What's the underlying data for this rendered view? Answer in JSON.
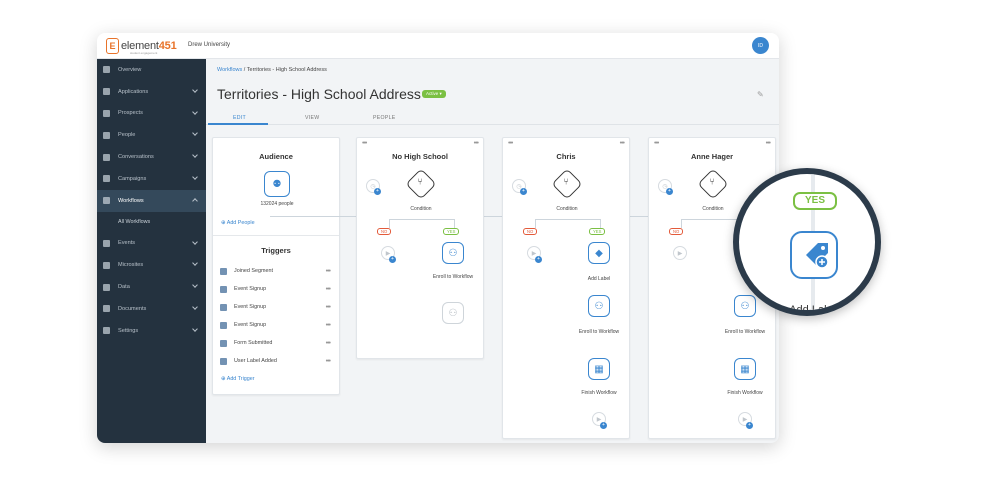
{
  "topbar": {
    "logo_text": "element",
    "logo_num": "451",
    "logo_sub": "student engagement",
    "institution": "Drew University",
    "avatar_initials": "ID"
  },
  "sidebar": {
    "items": [
      {
        "label": "Overview"
      },
      {
        "label": "Applications"
      },
      {
        "label": "Prospects"
      },
      {
        "label": "People"
      },
      {
        "label": "Conversations"
      },
      {
        "label": "Campaigns"
      },
      {
        "label": "Workflows"
      },
      {
        "label": "Events"
      },
      {
        "label": "Microsites"
      },
      {
        "label": "Data"
      },
      {
        "label": "Documents"
      },
      {
        "label": "Settings"
      }
    ],
    "sub_item": "All Workflows"
  },
  "header": {
    "breadcrumb_root": "Workflows",
    "breadcrumb_sep": "/",
    "breadcrumb_current": "Territories - High School Address",
    "title": "Territories - High School Address",
    "status": "Active"
  },
  "tabs": [
    {
      "label": "EDIT"
    },
    {
      "label": "VIEW"
    },
    {
      "label": "PEOPLE"
    }
  ],
  "audience": {
    "title": "Audience",
    "count": "132024 people",
    "add_people": "Add People"
  },
  "triggers": {
    "title": "Triggers",
    "items": [
      {
        "label": "Joined Segment"
      },
      {
        "label": "Event Signup"
      },
      {
        "label": "Event Signup"
      },
      {
        "label": "Event Signup"
      },
      {
        "label": "Form Submitted"
      },
      {
        "label": "User Label Added"
      }
    ],
    "add_trigger": "Add Trigger"
  },
  "columns": [
    {
      "title": "No High School",
      "condition": "Condition",
      "no": "NO",
      "yes": "YES",
      "yes_action": "Enroll to Workflow"
    },
    {
      "title": "Chris",
      "condition": "Condition",
      "no": "NO",
      "yes": "YES",
      "actions": [
        "Add Label",
        "Enroll to Workflow",
        "Finish Workflow"
      ]
    },
    {
      "title": "Anne Hager",
      "condition": "Condition",
      "no": "NO",
      "actions": [
        "Enroll to Workflow",
        "Finish Workflow"
      ]
    }
  ],
  "zoom": {
    "yes": "YES",
    "label": "Add Label"
  },
  "colors": {
    "accent": "#3a86cf",
    "sidebar": "#24323f",
    "yes": "#7bc043",
    "no": "#e35a3a",
    "brand": "#e8732a"
  }
}
